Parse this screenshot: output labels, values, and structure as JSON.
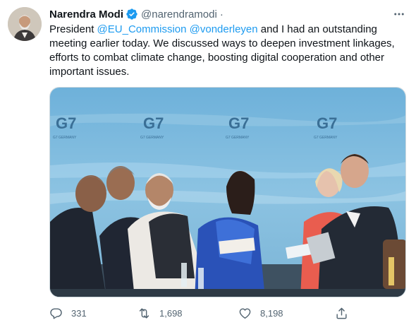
{
  "tweet": {
    "author_name": "Narendra Modi",
    "author_handle": "@narendramodi",
    "separator": "·",
    "text_before": "President ",
    "mention_1": "@EU_Commission",
    "text_between": " ",
    "mention_2": "@vonderleyen",
    "text_after": " and I had an outstanding meeting earlier today. We discussed ways to deepen investment linkages, efforts to combat climate change, boosting digital cooperation and other important issues.",
    "media": {
      "backdrop_logo_text": "G7",
      "backdrop_caption": "G7 GERMANY"
    },
    "stats": {
      "replies": "331",
      "retweets": "1,698",
      "likes": "8,198"
    }
  },
  "colors": {
    "accent": "#1d9bf0",
    "muted": "#536471",
    "text": "#0f1419",
    "backdrop": "#7fb8d9"
  },
  "icons": {
    "verified": "verified-badge-icon",
    "more": "more-dots-icon",
    "reply": "reply-icon",
    "retweet": "retweet-icon",
    "like": "heart-icon",
    "share": "share-icon"
  }
}
